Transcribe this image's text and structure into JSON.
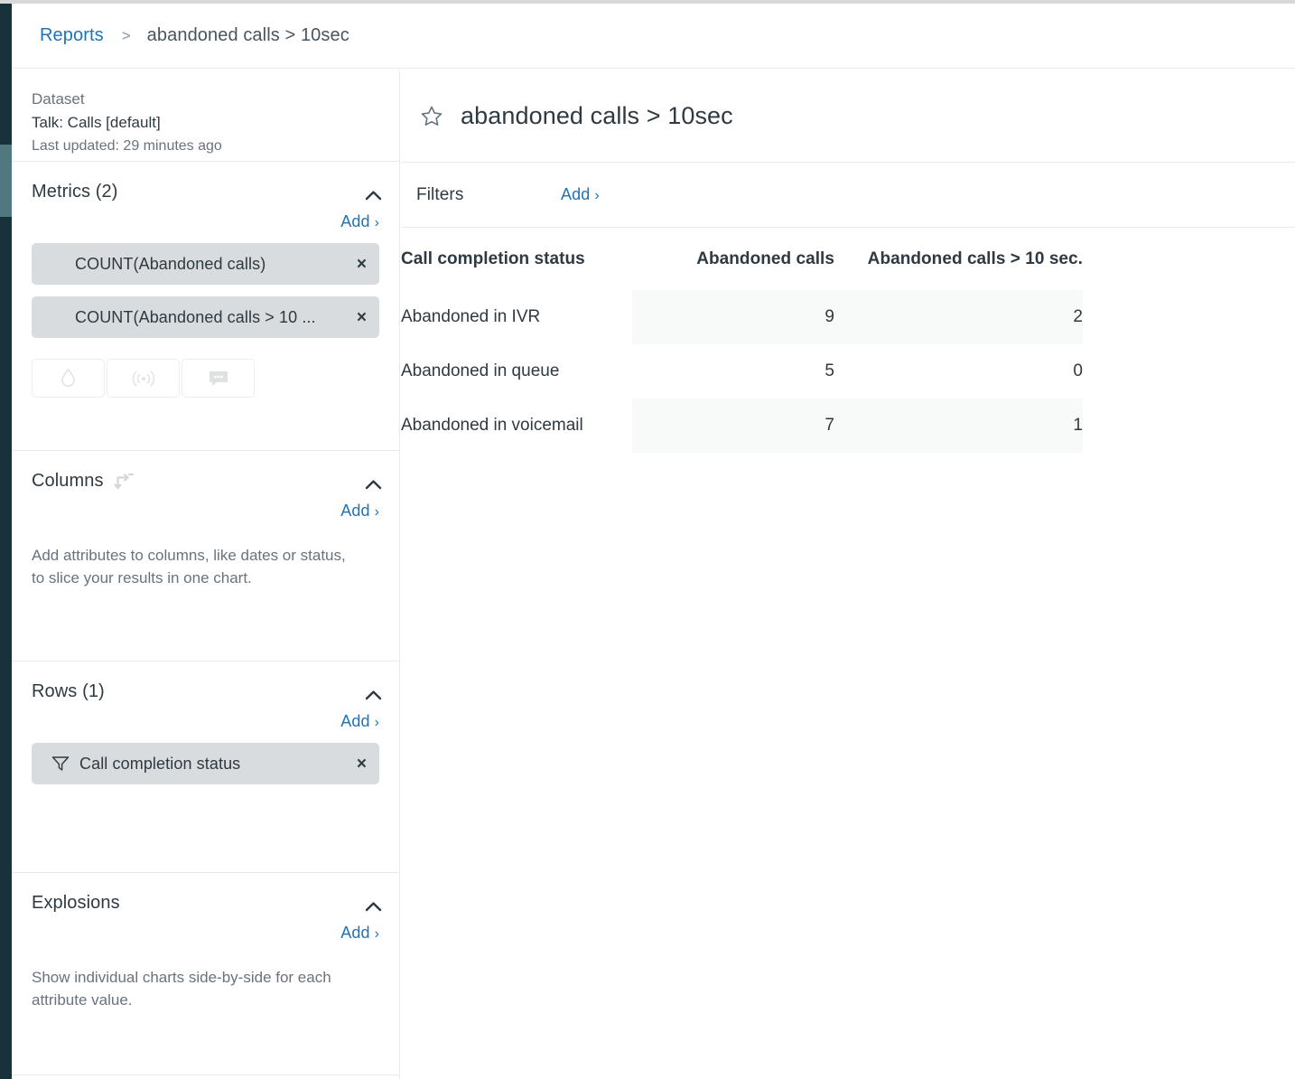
{
  "breadcrumb": {
    "root_label": "Reports",
    "separator": ">",
    "current_label": "abandoned calls > 10sec"
  },
  "left_panel": {
    "dataset": {
      "label": "Dataset",
      "name": "Talk: Calls [default]",
      "updated": "Last updated: 29 minutes ago"
    },
    "metrics": {
      "title": "Metrics (2)",
      "add_label": "Add",
      "add_chevron": "›",
      "collapse_icon": "chevron-up-icon",
      "chips": [
        {
          "label": "COUNT(Abandoned calls)",
          "remove": "×"
        },
        {
          "label": "COUNT(Abandoned calls > 10 ...",
          "remove": "×"
        }
      ],
      "icon_buttons": [
        {
          "name": "droplet-icon"
        },
        {
          "name": "broadcast-icon"
        },
        {
          "name": "comment-icon"
        }
      ]
    },
    "columns": {
      "title": "Columns",
      "swap_icon": "swap-arrows-icon",
      "add_label": "Add",
      "add_chevron": "›",
      "description": "Add attributes to columns, like dates or status, to slice your results in one chart."
    },
    "rows": {
      "title": "Rows (1)",
      "add_label": "Add",
      "add_chevron": "›",
      "chips": [
        {
          "icon": "filter-icon",
          "label": "Call completion status",
          "remove": "×"
        }
      ]
    },
    "explosions": {
      "title": "Explosions",
      "add_label": "Add",
      "add_chevron": "›",
      "description": "Show individual charts side-by-side for each attribute value."
    }
  },
  "report": {
    "star_icon": "star-outline-icon",
    "title": "abandoned calls > 10sec",
    "filters": {
      "label": "Filters",
      "add_label": "Add",
      "add_chevron": "›"
    }
  },
  "chart_data": {
    "type": "table",
    "title": "abandoned calls > 10sec",
    "categories": [
      "Abandoned in IVR",
      "Abandoned in queue",
      "Abandoned in voicemail"
    ],
    "columns": [
      "Call completion status",
      "Abandoned calls",
      "Abandoned calls > 10 sec."
    ],
    "series": [
      {
        "name": "Abandoned calls",
        "values": [
          9,
          5,
          7
        ]
      },
      {
        "name": "Abandoned calls > 10 sec.",
        "values": [
          2,
          0,
          1
        ]
      }
    ],
    "rows": [
      {
        "status": "Abandoned in IVR",
        "abandoned_calls": "9",
        "abandoned_calls_gt_10s": "2"
      },
      {
        "status": "Abandoned in queue",
        "abandoned_calls": "5",
        "abandoned_calls_gt_10s": "0"
      },
      {
        "status": "Abandoned in voicemail",
        "abandoned_calls": "7",
        "abandoned_calls_gt_10s": "1"
      }
    ]
  },
  "colors": {
    "rail": "#17323b",
    "rail_thumb": "#51787f",
    "link": "#1f73b7",
    "chip_bg": "#d8dcde",
    "text": "#2f3941",
    "muted": "#68737d",
    "row_shade": "#f8f9f9",
    "border": "#e9ebed"
  }
}
